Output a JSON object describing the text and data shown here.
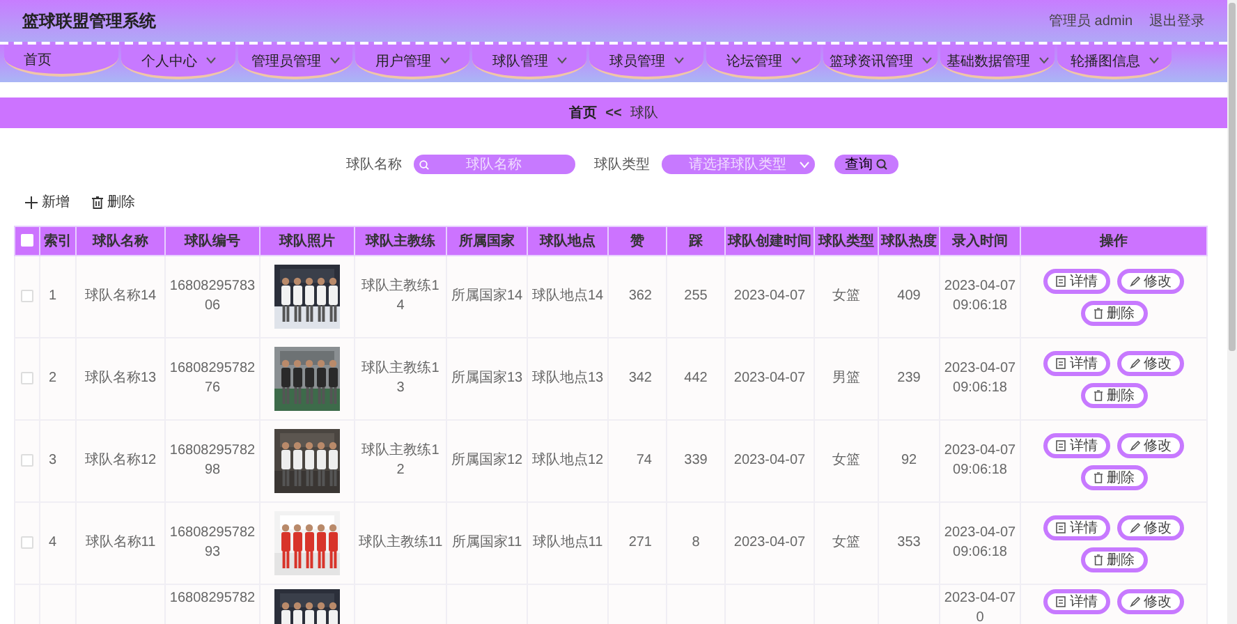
{
  "header": {
    "title": "篮球联盟管理系统",
    "user": "管理员 admin",
    "logout": "退出登录"
  },
  "nav": [
    {
      "label": "首页",
      "dropdown": false
    },
    {
      "label": "个人中心",
      "dropdown": true
    },
    {
      "label": "管理员管理",
      "dropdown": true
    },
    {
      "label": "用户管理",
      "dropdown": true
    },
    {
      "label": "球队管理",
      "dropdown": true
    },
    {
      "label": "球员管理",
      "dropdown": true
    },
    {
      "label": "论坛管理",
      "dropdown": true
    },
    {
      "label": "篮球资讯管理",
      "dropdown": true
    },
    {
      "label": "基础数据管理",
      "dropdown": true
    },
    {
      "label": "轮播图信息",
      "dropdown": true
    }
  ],
  "breadcrumb": {
    "home": "首页",
    "separator": "<<",
    "current": "球队"
  },
  "search": {
    "name_label": "球队名称",
    "name_placeholder": "球队名称",
    "type_label": "球队类型",
    "type_placeholder": "请选择球队类型",
    "query_button": "查询"
  },
  "actions": {
    "add": "新增",
    "delete": "删除"
  },
  "table": {
    "select_all_checked": false,
    "columns": [
      "索引",
      "球队名称",
      "球队编号",
      "球队照片",
      "球队主教练",
      "所属国家",
      "球队地点",
      "赞",
      "踩",
      "球队创建时间",
      "球队类型",
      "球队热度",
      "录入时间",
      "操作"
    ],
    "rows": [
      {
        "checked": false,
        "index": "1",
        "name": "球队名称14",
        "number": "1680829578306",
        "photo": {
          "kind": "picture"
        },
        "coach": "球队主教练14",
        "country": "所属国家14",
        "location": "球队地点14",
        "likes": "362",
        "dislikes": "255",
        "created": "2023-04-07",
        "type": "女篮",
        "heat": "409",
        "entered": "2023-04-07 09:06:18",
        "buttons": [
          "详情",
          "修改",
          "删除"
        ]
      },
      {
        "checked": false,
        "index": "2",
        "name": "球队名称13",
        "number": "1680829578276",
        "photo": {
          "kind": "picture"
        },
        "coach": "球队主教练13",
        "country": "所属国家13",
        "location": "球队地点13",
        "likes": "342",
        "dislikes": "442",
        "created": "2023-04-07",
        "type": "男篮",
        "heat": "239",
        "entered": "2023-04-07 09:06:18",
        "buttons": [
          "详情",
          "修改",
          "删除"
        ]
      },
      {
        "checked": false,
        "index": "3",
        "name": "球队名称12",
        "number": "1680829578298",
        "photo": {
          "kind": "picture"
        },
        "coach": "球队主教练12",
        "country": "所属国家12",
        "location": "球队地点12",
        "likes": "74",
        "dislikes": "339",
        "created": "2023-04-07",
        "type": "女篮",
        "heat": "92",
        "entered": "2023-04-07 09:06:18",
        "buttons": [
          "详情",
          "修改",
          "删除"
        ]
      },
      {
        "checked": false,
        "index": "4",
        "name": "球队名称11",
        "number": "1680829578293",
        "photo": {
          "kind": "picture"
        },
        "coach": "球队主教练11",
        "country": "所属国家11",
        "location": "球队地点11",
        "likes": "271",
        "dislikes": "8",
        "created": "2023-04-07",
        "type": "女篮",
        "heat": "353",
        "entered": "2023-04-07 09:06:18",
        "buttons": [
          "详情",
          "修改",
          "删除"
        ]
      },
      {
        "number": "16808295782",
        "photo": {
          "kind": "picture"
        },
        "entered": "2023-04-07 0",
        "buttons": [
          "详情",
          "修改"
        ]
      }
    ]
  }
}
